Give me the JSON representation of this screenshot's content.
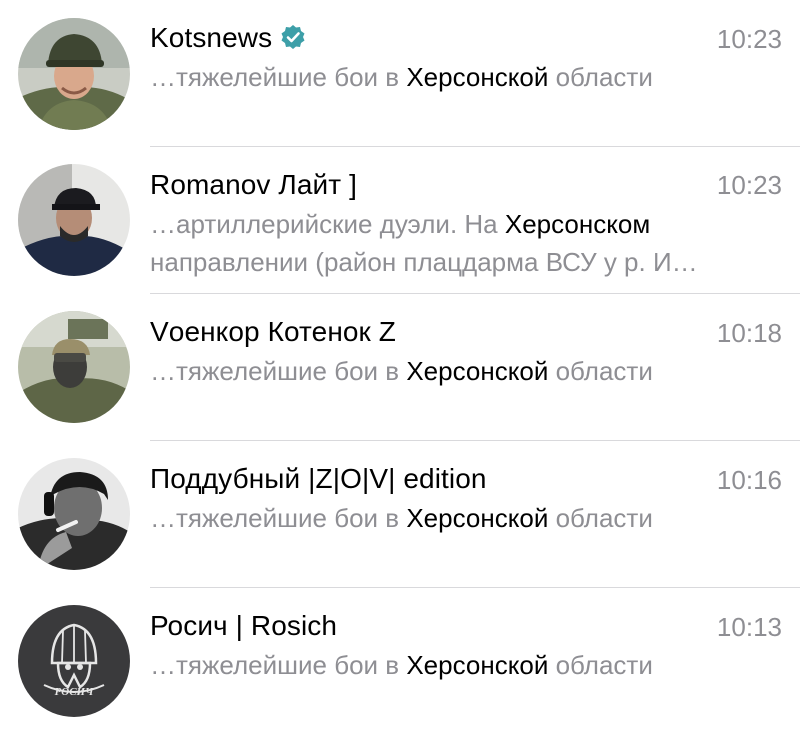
{
  "chats": [
    {
      "name": "Kotsnews",
      "verified": true,
      "time": "10:23",
      "preview": {
        "pre": "…тяжелейшие бои в ",
        "hl": "Херсонской",
        "post": " области"
      },
      "avatar": "soldier-in-helmet-photo"
    },
    {
      "name": "Romanov Лайт ]",
      "verified": false,
      "time": "10:23",
      "preview": {
        "pre": "…артиллерийские дуэли. На ",
        "hl": "Херсонском",
        "line2": "направлении (район плацдарма ВСУ у р. И…"
      },
      "avatar": "man-in-cap-photo"
    },
    {
      "name": "Vоенкор Котенок Z",
      "verified": false,
      "time": "10:18",
      "preview": {
        "pre": "…тяжелейшие бои в ",
        "hl": "Херсонской",
        "post": " области"
      },
      "avatar": "masked-soldier-photo"
    },
    {
      "name": "Поддубный |Z|O|V| edition",
      "verified": false,
      "time": "10:16",
      "preview": {
        "pre": "…тяжелейшие бои в ",
        "hl": "Херсонской",
        "post": " области"
      },
      "avatar": "bw-man-smoking-photo"
    },
    {
      "name": "Росич | Rosich",
      "verified": false,
      "time": "10:13",
      "preview": {
        "pre": "…тяжелейшие бои в ",
        "hl": "Херсонской",
        "post": " области"
      },
      "avatar": "rosich-helmet-logo",
      "logo_text": "РОСИЧ"
    }
  ],
  "colors": {
    "secondary_text": "#8e8e93",
    "verified_badge": "#3d9fa8",
    "divider": "#d9d9dc"
  }
}
